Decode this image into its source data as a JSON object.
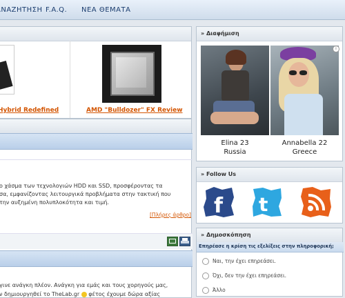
{
  "nav": {
    "items": [
      "ΑΝΑΖΗΤΗΣΗ",
      "F.A.Q.",
      "ΝΕΑ ΘΕΜΑΤΑ"
    ]
  },
  "featured": {
    "left_title": "Hybrid Redefined",
    "right_title": "AMD \"Bulldozer\" FX Review"
  },
  "article": {
    "line1": "ο χάσμα των τεχνολογιών HDD και SSD, προσφέροντας τα",
    "line2": "σα, εμφανίζοντας λειτουργικά προβλήματα στην τακτική που",
    "line3": "την αυξημένη πολυπλοκότητα και τιμή.",
    "more_link": "[Πλήρες άρθρο]"
  },
  "article2": {
    "line1": "γινε ανάγκη πλέον. Ανάγκη για εμάς και τους χορηγούς μας,",
    "line2": "ν δημιουργηθεί το TheLab.gr",
    "line2b": "φέτος έχουμε δώρα αξίας"
  },
  "ad": {
    "header": "» Διαφήμιση",
    "people": [
      {
        "name": "Elina 23",
        "country": "Russia"
      },
      {
        "name": "Annabella 22",
        "country": "Greece"
      }
    ]
  },
  "follow": {
    "header": "» Follow Us",
    "icons": [
      "facebook",
      "twitter",
      "rss"
    ]
  },
  "poll": {
    "header": "» Δημοσκόπηση",
    "question": "Επηρέασε η κρίση τις εξελίξεις στην πληροφορική;",
    "options": [
      "Ναι, την έχει επηρεάσει.",
      "Όχι, δεν την έχει επηρεάσει.",
      "Άλλο"
    ]
  },
  "colors": {
    "link": "#d35400",
    "facebook": "#2b4a8b",
    "twitter": "#2ea7e0",
    "rss": "#e8601a"
  }
}
